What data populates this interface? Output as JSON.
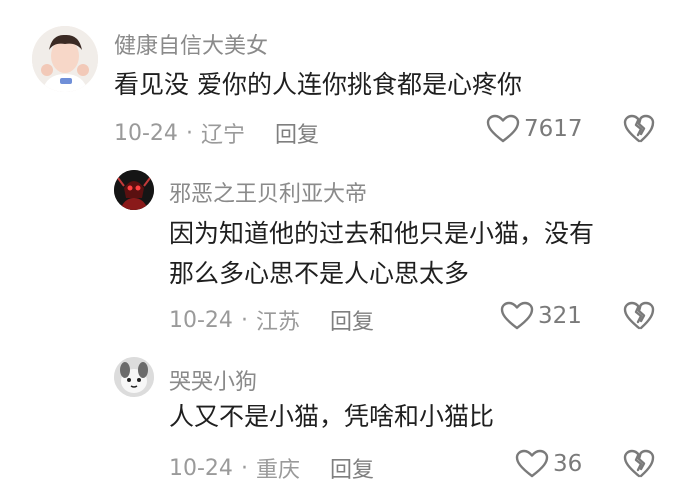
{
  "comments": [
    {
      "username": "健康自信大美女",
      "text": "看见没 爱你的人连你挑食都是心疼你",
      "date": "10-24",
      "location": "辽宁",
      "reply_label": "回复",
      "likes": "7617"
    },
    {
      "username": "邪恶之王贝利亚大帝",
      "text_lines": [
        "因为知道他的过去和他只是小猫，没有",
        "那么多心思不是人心思太多"
      ],
      "date": "10-24",
      "location": "江苏",
      "reply_label": "回复",
      "likes": "321"
    },
    {
      "username": "哭哭小狗",
      "text": "人又不是小猫，凭啥和小猫比",
      "date": "10-24",
      "location": "重庆",
      "reply_label": "回复",
      "likes": "36"
    }
  ],
  "separator": "·",
  "icons": {
    "like": "heart-outline-icon",
    "dislike": "broken-heart-icon"
  },
  "colors": {
    "username": "#8a8a8a",
    "text": "#1f1f1f",
    "meta": "#9a9a9a"
  }
}
